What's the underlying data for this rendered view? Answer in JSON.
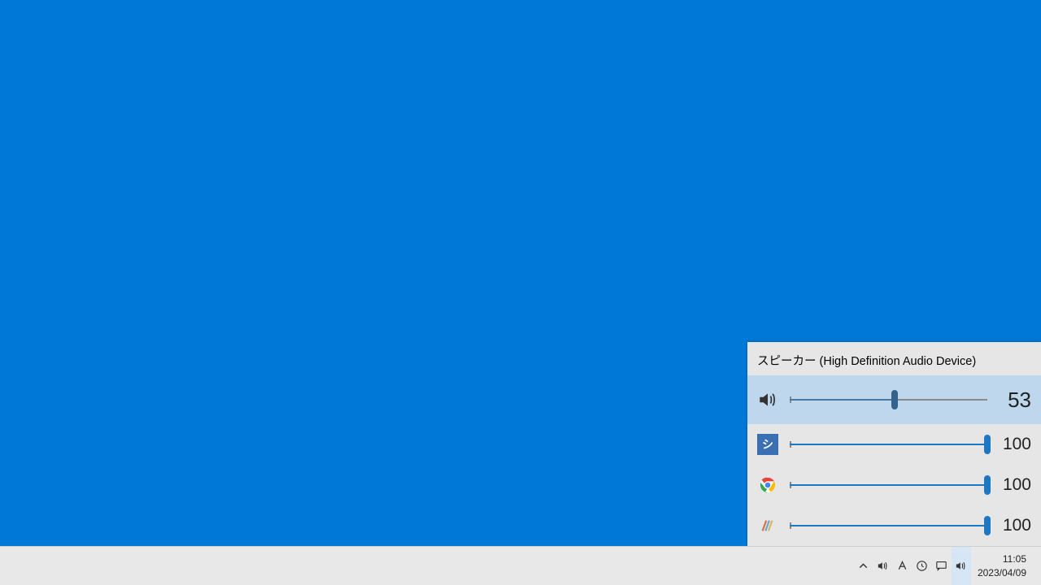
{
  "mixer": {
    "device_label": "スピーカー (High Definition Audio Device)",
    "master": {
      "value": 53,
      "value_text": "53"
    },
    "apps": [
      {
        "id": "system-sounds",
        "icon_letter": "シ",
        "value": 100,
        "value_text": "100"
      },
      {
        "id": "chrome",
        "icon_letter": "",
        "value": 100,
        "value_text": "100"
      },
      {
        "id": "stripes-app",
        "icon_letter": "",
        "value": 100,
        "value_text": "100"
      }
    ]
  },
  "taskbar": {
    "time": "11:05",
    "date": "2023/04/09"
  }
}
